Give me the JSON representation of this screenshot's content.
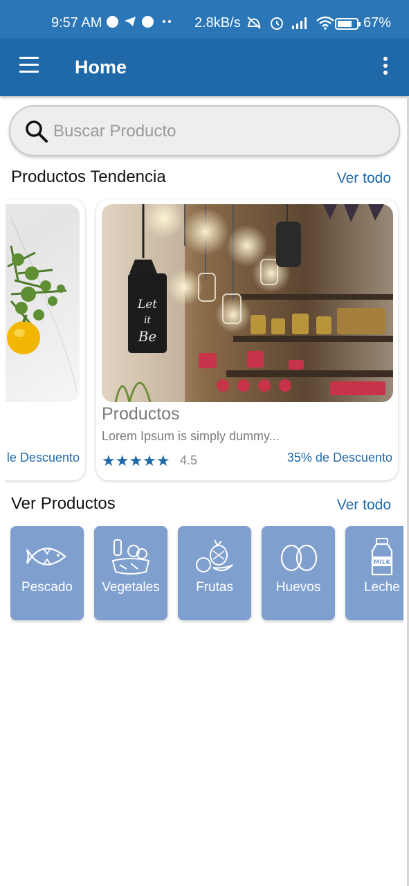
{
  "status_bar": {
    "time": "9:57 AM",
    "net_speed": "2.8kB/s",
    "battery": "67%",
    "icons": [
      "messenger-icon",
      "telegram-icon",
      "facebook-icon",
      "more-dots-icon",
      "mute-icon",
      "alarm-icon",
      "signal-icon",
      "wifi-icon",
      "battery-icon"
    ]
  },
  "app_bar": {
    "title": "Home"
  },
  "search": {
    "placeholder": "Buscar Producto"
  },
  "trending": {
    "title": "Productos Tendencia",
    "see_all": "Ver todo",
    "partial_card": {
      "discount": "le Descuento"
    },
    "card": {
      "name": "Productos",
      "description": "Lorem Ipsum is simply dummy...",
      "stars": "★★★★★",
      "rating": "4.5",
      "discount": "35% de Descuento",
      "sign_text": "Let it Be"
    }
  },
  "categories": {
    "title": "Ver Productos",
    "see_all": "Ver todo",
    "items": [
      {
        "label": "Pescado",
        "icon": "fish-icon"
      },
      {
        "label": "Vegetales",
        "icon": "vegetables-icon"
      },
      {
        "label": "Frutas",
        "icon": "fruits-icon"
      },
      {
        "label": "Huevos",
        "icon": "eggs-icon"
      },
      {
        "label": "Leche",
        "icon": "milk-icon",
        "icon_text": "MILK"
      }
    ]
  },
  "colors": {
    "primary": "#1f69a8",
    "status_bar": "#2a76b7",
    "category_tile": "#7f9fcf"
  }
}
